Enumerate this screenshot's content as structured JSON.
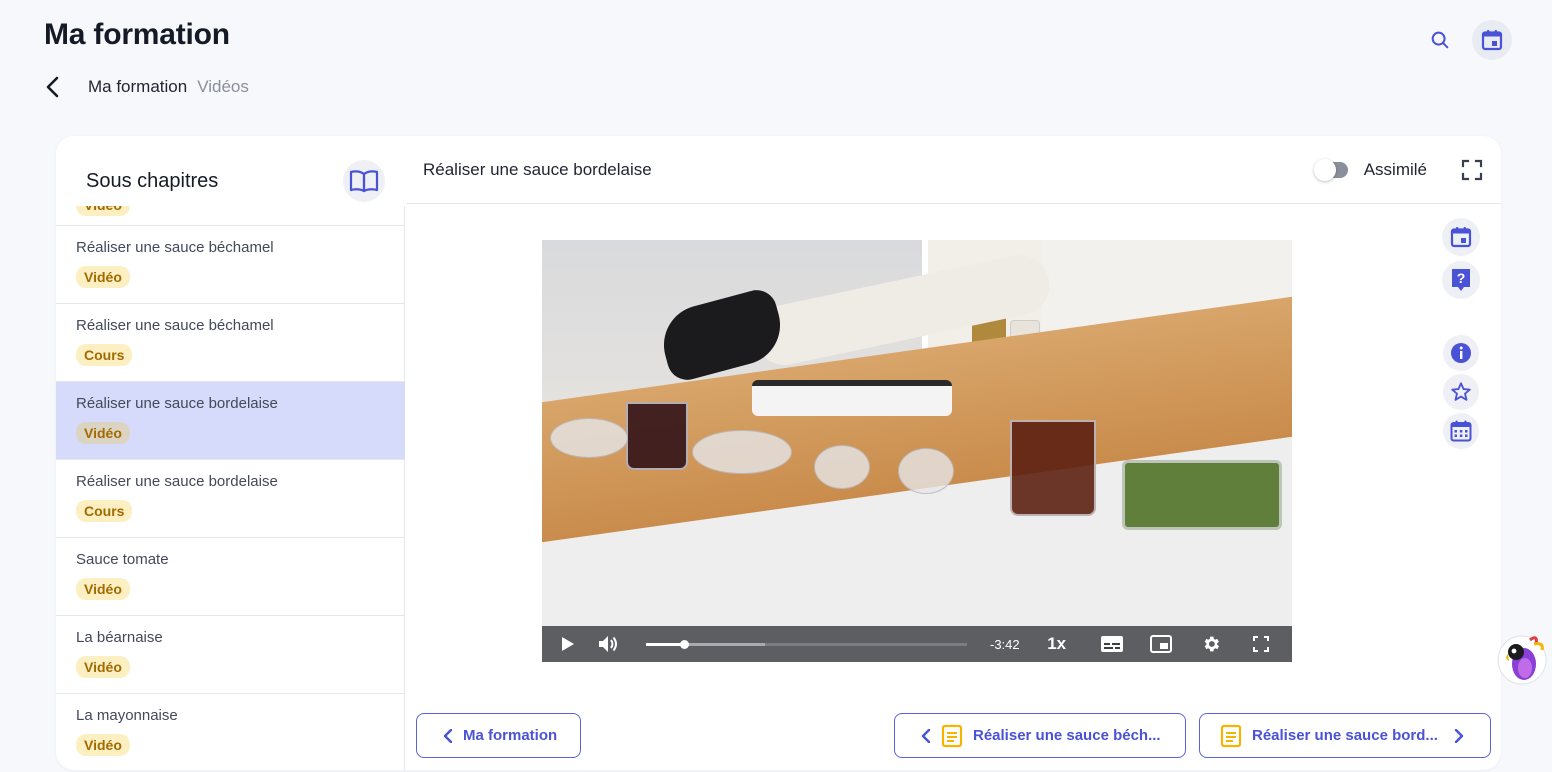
{
  "page": {
    "title": "Ma formation",
    "accent_color": "#4a52d6",
    "badge_color": "#fcefc2",
    "active_item_color": "#d6dbfb"
  },
  "header_actions": {
    "icons": [
      "search-icon",
      "calendar-icon"
    ]
  },
  "breadcrumb": {
    "items": [
      "Ma formation",
      "Vidéos"
    ]
  },
  "sidebar": {
    "title": "Sous chapitres",
    "partial_item_badge": "Vidéo",
    "items": [
      {
        "label": "Réaliser une sauce béchamel",
        "badge": "Vidéo",
        "active": false
      },
      {
        "label": "Réaliser une sauce béchamel",
        "badge": "Cours",
        "active": false
      },
      {
        "label": "Réaliser une sauce bordelaise",
        "badge": "Vidéo",
        "active": true
      },
      {
        "label": "Réaliser une sauce bordelaise",
        "badge": "Cours",
        "active": false
      },
      {
        "label": "Sauce tomate",
        "badge": "Vidéo",
        "active": false
      },
      {
        "label": "La béarnaise",
        "badge": "Vidéo",
        "active": false
      },
      {
        "label": "La mayonnaise",
        "badge": "Vidéo",
        "active": false
      }
    ]
  },
  "content": {
    "title": "Réaliser une sauce bordelaise",
    "toggle_label": "Assimilé",
    "toggle_on": false
  },
  "player": {
    "time_remaining": "-3:42",
    "playback_rate": "1x",
    "progress_fraction": 0.12,
    "buffered_fraction": 0.37
  },
  "side_tools": [
    "calendar-icon",
    "help-icon",
    "info-icon",
    "star-icon",
    "calendar-grid-icon"
  ],
  "navigation": {
    "back_label": "Ma formation",
    "prev_label": "Réaliser une sauce béch...",
    "next_label": "Réaliser une sauce bord..."
  }
}
